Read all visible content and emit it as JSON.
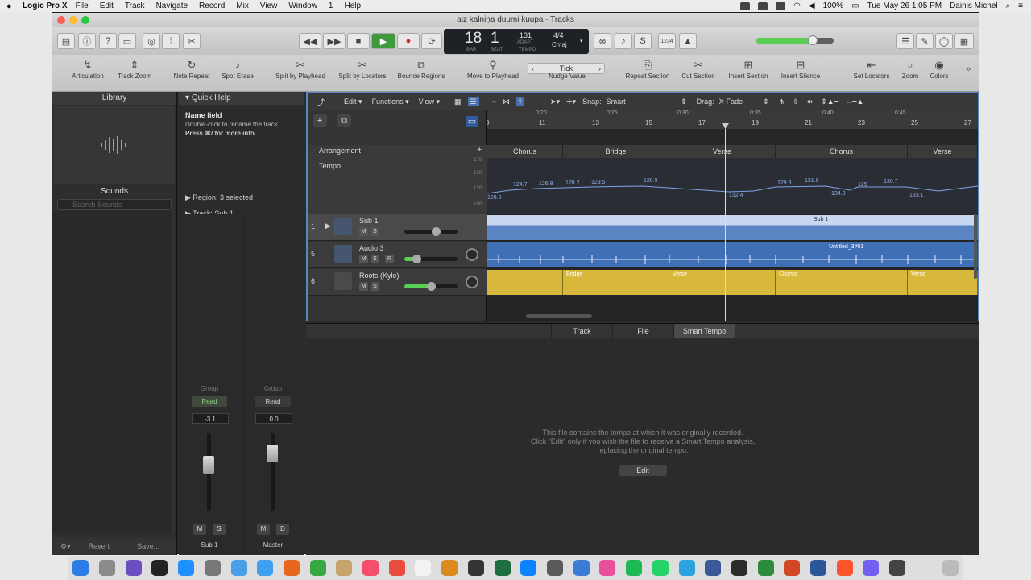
{
  "menubar": {
    "app": "Logic Pro X",
    "items": [
      "File",
      "Edit",
      "Track",
      "Navigate",
      "Record",
      "Mix",
      "View",
      "Window",
      "1",
      "Help"
    ],
    "battery": "100%",
    "datetime": "Tue May 26  1:05 PM",
    "user": "Dainis Michel"
  },
  "window": {
    "title": "aiz kalniņa duumi kuupa - Tracks"
  },
  "lcd": {
    "bar": "18",
    "beat": "1",
    "bar_label": "BAR",
    "beat_label": "BEAT",
    "tempo": "131",
    "tempo_mode": "ADAPT",
    "tempo_label": "TEMPO",
    "signature": "4/4",
    "key": "Cmaj"
  },
  "controlbar": {
    "count_in": "1234"
  },
  "toolbar": {
    "tools": [
      "Articulation",
      "Track Zoom",
      "Note Repeat",
      "Spot Erase",
      "Split by Playhead",
      "Split by Locators",
      "Bounce Regions",
      "Move to Playhead",
      "Nudge Value",
      "Repeat Section",
      "Cut Section",
      "Insert Section",
      "Insert Silence",
      "Set Locators",
      "Zoom",
      "Colors"
    ],
    "nudge": "Tick"
  },
  "library": {
    "title": "Library",
    "sounds": "Sounds",
    "search_placeholder": "Search Sounds",
    "revert": "Revert",
    "save": "Save..."
  },
  "quickhelp": {
    "title": "Quick Help",
    "heading": "Name field",
    "line1": "Double-click to rename the track.",
    "line2": "Press ⌘/ for more info.",
    "region": "Region:  3 selected",
    "track": "Track:  Sub 1"
  },
  "strips": [
    {
      "group": "Group",
      "mode": "Read",
      "value": "-3.1",
      "m": "M",
      "s": "S",
      "name": "Sub 1"
    },
    {
      "group": "Group",
      "mode": "Read",
      "value": "0.0",
      "m": "M",
      "s": "D",
      "name": "Master"
    }
  ],
  "tracksbar": {
    "edit": "Edit",
    "functions": "Functions",
    "view": "View",
    "snap_label": "Snap:",
    "snap": "Smart",
    "drag_label": "Drag:",
    "drag": "X-Fade"
  },
  "globals": {
    "arrangement": "Arrangement",
    "tempo": "Tempo",
    "scale": [
      "170",
      "150",
      "130",
      "100"
    ]
  },
  "tracks": [
    {
      "num": "1",
      "name": "Sub 1",
      "m": "M",
      "s": "S",
      "volume": 0.62
    },
    {
      "num": "5",
      "name": "Audio 3",
      "m": "M",
      "s": "S",
      "r": "R",
      "volume": 0.2
    },
    {
      "num": "6",
      "name": "Roots (Kyle)",
      "m": "M",
      "s": "S",
      "volume": 0.55
    }
  ],
  "ruler": {
    "bars": [
      "9",
      "11",
      "13",
      "15",
      "17",
      "19",
      "21",
      "23",
      "25",
      "27"
    ],
    "times": [
      "0:20",
      "0:25",
      "0:30",
      "0:35",
      "0:40",
      "0:45"
    ]
  },
  "arrangement_markers": [
    "Chorus",
    "Bridge",
    "Verse",
    "Chorus",
    "Verse"
  ],
  "tempo_values": [
    "128.9",
    "124.7",
    "126.8",
    "128.2",
    "129.5",
    "130.9",
    "132.4",
    "129.3",
    "131.6",
    "134.3",
    "125",
    "130.7",
    "133.1"
  ],
  "regions": {
    "sub": "Sub 1",
    "audio": "Untitled_3#01",
    "roots": [
      "Bridge",
      "Verse",
      "Chorus",
      "Verse"
    ]
  },
  "editor": {
    "tabs": [
      "Track",
      "File",
      "Smart Tempo"
    ],
    "msg1": "This file contains the tempo at which it was originally recorded.",
    "msg2": "Click “Edit” only if you wish the file to receive a Smart Tempo analysis,",
    "msg3": "replacing the original tempo.",
    "edit_button": "Edit"
  },
  "colors": {
    "accent": "#5a86c8",
    "region_blue": "#4477bb",
    "region_yellow": "#d8b83a",
    "tempo_line": "#7fa3e8"
  }
}
